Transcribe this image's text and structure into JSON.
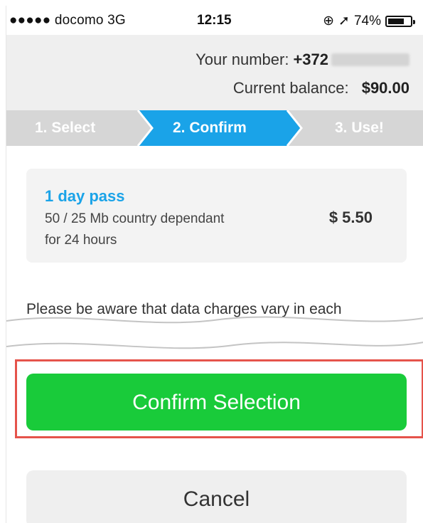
{
  "status_bar": {
    "carrier": "●●●●● docomo  3G",
    "time": "12:15",
    "battery_percent": "74%",
    "battery_level": 0.74
  },
  "account": {
    "number_label": "Your number:",
    "number_prefix": "+372",
    "balance_label": "Current balance:",
    "balance_value": "$90.00"
  },
  "steps": [
    {
      "label": "1. Select",
      "active": false
    },
    {
      "label": "2. Confirm",
      "active": true
    },
    {
      "label": "3. Use!",
      "active": false
    }
  ],
  "pass": {
    "title": "1 day pass",
    "line1": "50 / 25 Mb  country dependant",
    "line2": "for 24 hours",
    "price": "$ 5.50"
  },
  "notice": "Please be aware that data charges vary in each",
  "buttons": {
    "confirm": "Confirm Selection",
    "cancel": "Cancel"
  },
  "colors": {
    "accent_blue": "#1aa3e8",
    "confirm_green": "#19cb3a",
    "highlight_red": "#e5534b"
  }
}
